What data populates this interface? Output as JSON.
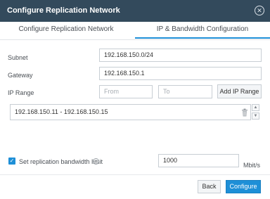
{
  "dialog": {
    "title": "Configure Replication Network",
    "close_icon": "close-circle-icon"
  },
  "tabs": [
    {
      "label": "Configure Replication Network",
      "active": false
    },
    {
      "label": "IP & Bandwidth Configuration",
      "active": true
    }
  ],
  "form": {
    "subnet": {
      "label": "Subnet",
      "value": "192.168.150.0/24"
    },
    "gateway": {
      "label": "Gateway",
      "value": "192.168.150.1"
    },
    "ip_range": {
      "label": "IP Range",
      "from_placeholder": "From",
      "to_placeholder": "To",
      "add_button": "Add IP Range"
    },
    "ranges": [
      "192.168.150.11 - 192.168.150.15"
    ],
    "bandwidth": {
      "checked": true,
      "label": "Set replication bandwidth limit",
      "value": "1000",
      "unit": "Mbit/s"
    }
  },
  "footer": {
    "back": "Back",
    "configure": "Configure"
  },
  "colors": {
    "titlebar": "#334a5c",
    "accent": "#1e8fd7"
  }
}
